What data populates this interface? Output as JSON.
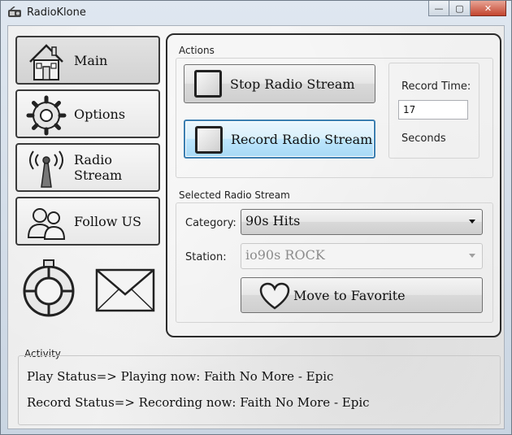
{
  "window": {
    "title": "RadioKlone",
    "minimize_glyph": "—",
    "maximize_glyph": "▢",
    "close_glyph": "✕"
  },
  "nav": [
    {
      "label": "Main",
      "icon": "house-icon",
      "active": true
    },
    {
      "label": "Options",
      "icon": "gear-icon",
      "active": false
    },
    {
      "label": "Radio Stream",
      "icon": "antenna-icon",
      "active": false
    },
    {
      "label": "Follow US",
      "icon": "people-icon",
      "active": false
    }
  ],
  "decorations": [
    "lifebuoy-icon",
    "envelope-icon"
  ],
  "actions": {
    "title": "Actions",
    "stop_button": "Stop Radio Stream",
    "record_button": "Record Radio Stream",
    "record_time_label": "Record Time:",
    "record_time_value": "17",
    "seconds_label": "Seconds"
  },
  "selected_stream": {
    "title": "Selected Radio Stream",
    "category_label": "Category:",
    "category_value": "90s Hits",
    "station_label": "Station:",
    "station_value": "io90s ROCK",
    "favorite_button": "Move to Favorite"
  },
  "activity": {
    "title": "Activity",
    "play_status": "Play Status=> Playing now: Faith No More - Epic",
    "record_status": "Record Status=> Recording now: Faith No More - Epic"
  }
}
